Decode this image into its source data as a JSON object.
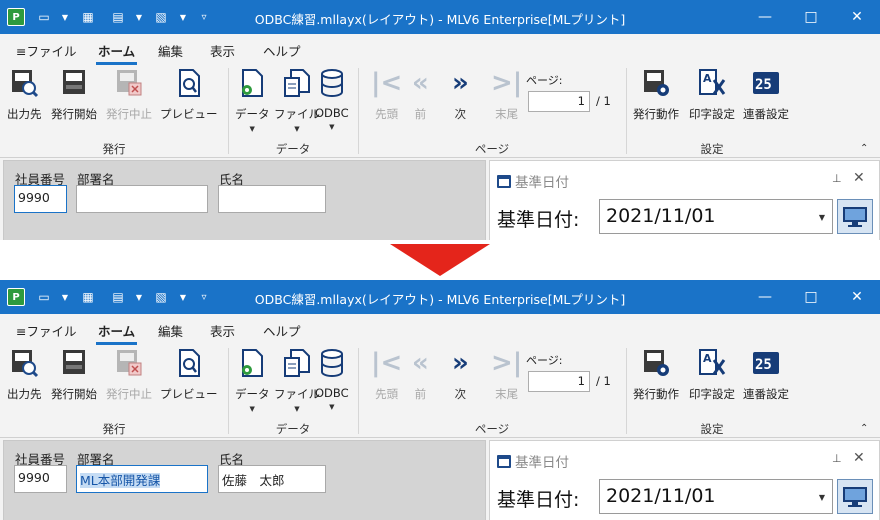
{
  "arrow_color": "#e4251b",
  "screens": [
    {
      "window": {
        "title": "ODBC練習.mllayx(レイアウト) - MLV6 Enterprise[MLプリント]",
        "app_icon": "P"
      },
      "menu": {
        "file": "ファイル",
        "home": "ホーム",
        "edit": "編集",
        "view": "表示",
        "help": "ヘルプ"
      },
      "ribbon": {
        "output": "出力先",
        "start": "発行開始",
        "stop": "発行中止",
        "preview": "プレビュー",
        "group_issue": "発行",
        "data": "データ",
        "file": "ファイル",
        "odbc": "ODBC",
        "group_data": "データ",
        "first": "先頭",
        "prev": "前",
        "next": "次",
        "last": "末尾",
        "page_label": "ページ:",
        "page_value": "1",
        "page_total": "/ 1",
        "group_page": "ページ",
        "action": "発行動作",
        "print_settings": "印字設定",
        "serial_settings": "連番設定",
        "group_settings": "設定"
      },
      "form": {
        "emp_label": "社員番号",
        "emp_value": "9990",
        "dept_label": "部署名",
        "dept_value": "",
        "name_label": "氏名",
        "name_value": ""
      },
      "side": {
        "title": "基準日付",
        "date_label": "基準日付:",
        "date_value": "2021/11/01"
      }
    },
    {
      "window": {
        "title": "ODBC練習.mllayx(レイアウト) - MLV6 Enterprise[MLプリント]",
        "app_icon": "P"
      },
      "menu": {
        "file": "ファイル",
        "home": "ホーム",
        "edit": "編集",
        "view": "表示",
        "help": "ヘルプ"
      },
      "ribbon": {
        "output": "出力先",
        "start": "発行開始",
        "stop": "発行中止",
        "preview": "プレビュー",
        "group_issue": "発行",
        "data": "データ",
        "file": "ファイル",
        "odbc": "ODBC",
        "group_data": "データ",
        "first": "先頭",
        "prev": "前",
        "next": "次",
        "last": "末尾",
        "page_label": "ページ:",
        "page_value": "1",
        "page_total": "/ 1",
        "group_page": "ページ",
        "action": "発行動作",
        "print_settings": "印字設定",
        "serial_settings": "連番設定",
        "group_settings": "設定"
      },
      "form": {
        "emp_label": "社員番号",
        "emp_value": "9990",
        "dept_label": "部署名",
        "dept_value": "ML本部開発課",
        "name_label": "氏名",
        "name_value": "佐藤　太郎"
      },
      "side": {
        "title": "基準日付",
        "date_label": "基準日付:",
        "date_value": "2021/11/01"
      }
    }
  ]
}
